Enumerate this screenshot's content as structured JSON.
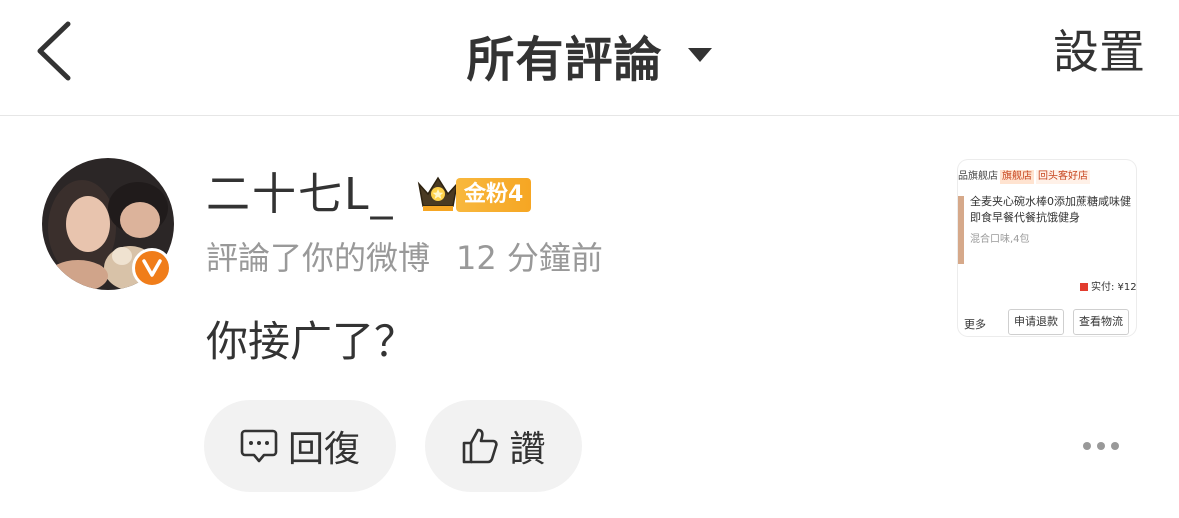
{
  "header": {
    "title": "所有評論",
    "settings_label": "設置"
  },
  "comment": {
    "username": "二十七L_",
    "fan_badge": "金粉4",
    "action_text": "評論了你的微博",
    "time_text": "12 分鐘前",
    "body": "你接广了？",
    "reply_label": "回復",
    "like_label": "讚"
  },
  "thumbnail": {
    "store_text": "品旗舰店",
    "store_tag": "旗舰店",
    "store_tag2": "回头客好店",
    "product_line1": "全麦夹心碗水棒0添加蔗糖咸味健",
    "product_line2": "即食早餐代餐抗饿健身",
    "variant": "混合口味,4包",
    "paid_label": "实付: ¥12",
    "more_label": "更多",
    "refund_label": "申请退款",
    "logistics_label": "查看物流"
  },
  "icons": {
    "back": "chevron-left-icon",
    "caret": "caret-down-icon",
    "verified": "verified-v-icon",
    "crown": "crown-icon",
    "reply": "comment-icon",
    "like": "thumbs-up-icon",
    "more": "more-dots-icon"
  },
  "colors": {
    "verified_orange": "#f07d1a",
    "fan_badge_gold": "#f6a623",
    "pill_bg": "#f2f2f2",
    "secondary_text": "#999999"
  }
}
